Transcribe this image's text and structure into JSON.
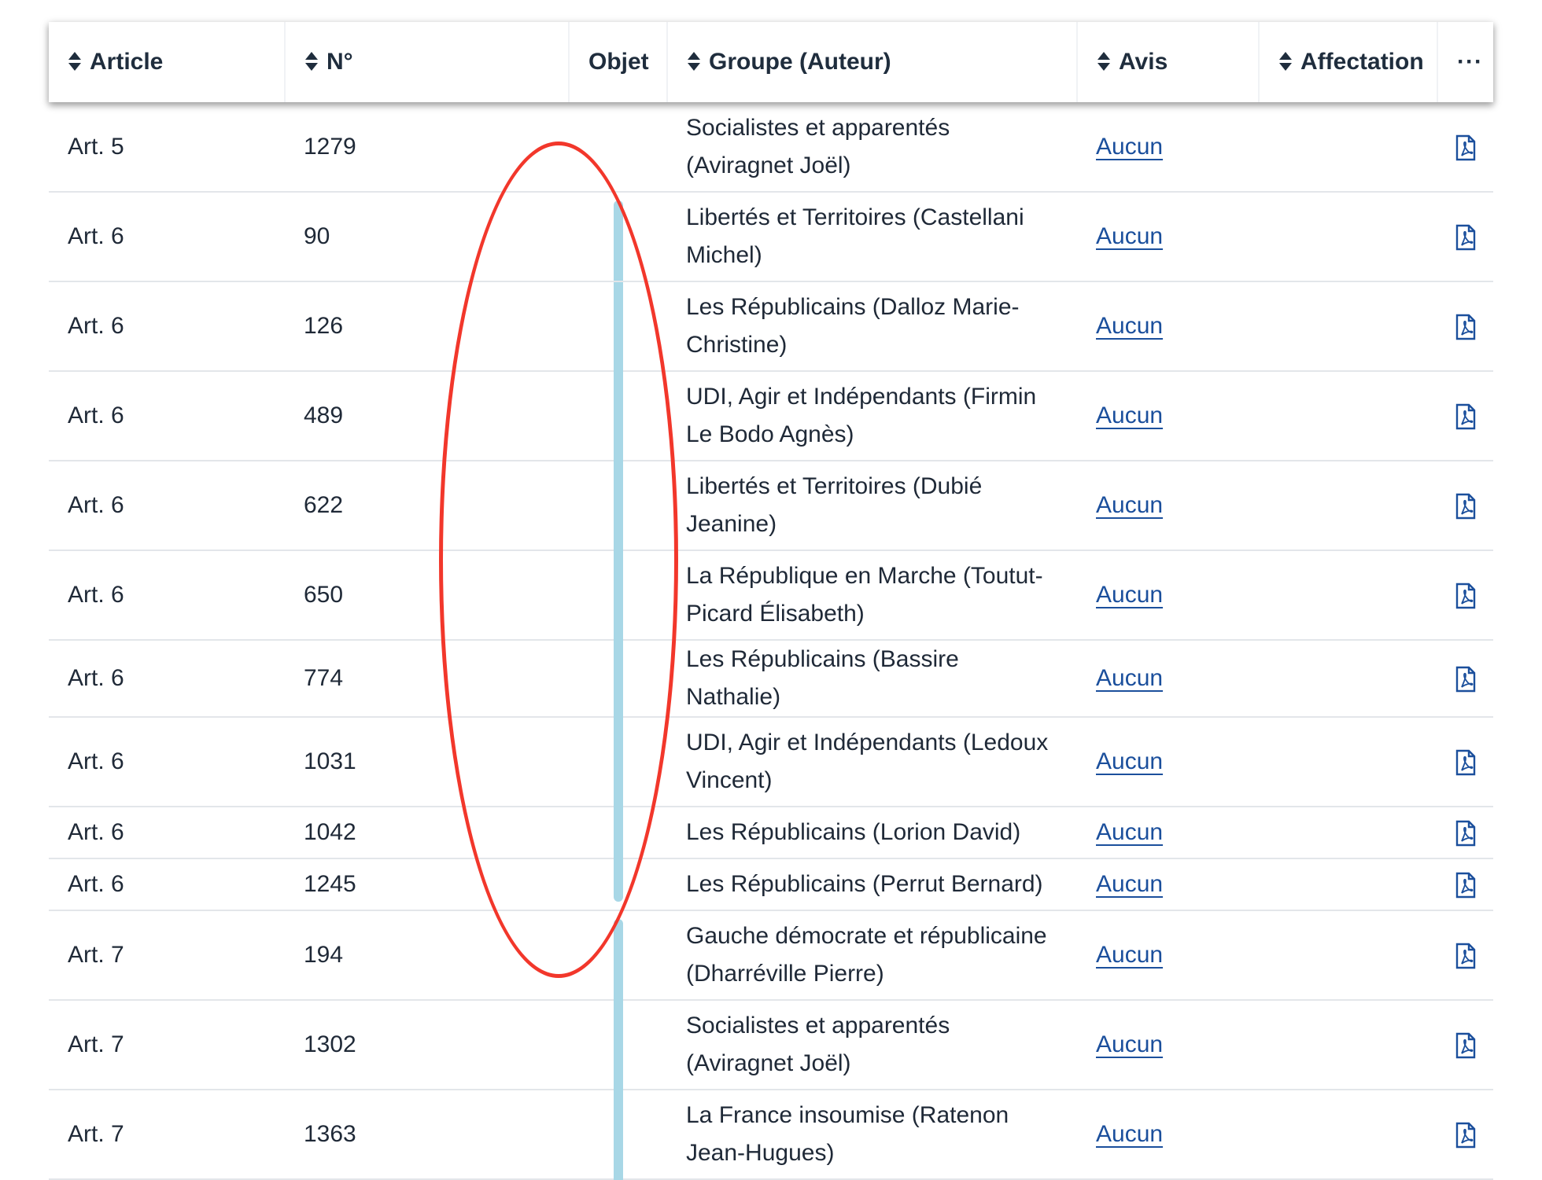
{
  "header": {
    "article": "Article",
    "numero": "N°",
    "objet": "Objet",
    "groupe": "Groupe (Auteur)",
    "avis": "Avis",
    "affectation": "Affectation",
    "more": "···"
  },
  "rows": [
    {
      "article": "Art. 5",
      "numero": "1279",
      "groupe": "Socialistes et apparentés (Aviragnet Joël)",
      "avis": "Aucun"
    },
    {
      "article": "Art. 6",
      "numero": "90",
      "groupe": "Libertés et Territoires (Castellani Michel)",
      "avis": "Aucun"
    },
    {
      "article": "Art. 6",
      "numero": "126",
      "groupe": "Les Républicains (Dalloz Marie-Christine)",
      "avis": "Aucun"
    },
    {
      "article": "Art. 6",
      "numero": "489",
      "groupe": "UDI, Agir et Indépendants (Firmin Le Bodo Agnès)",
      "avis": "Aucun"
    },
    {
      "article": "Art. 6",
      "numero": "622",
      "groupe": "Libertés et Territoires (Dubié Jeanine)",
      "avis": "Aucun"
    },
    {
      "article": "Art. 6",
      "numero": "650",
      "groupe": "La République en Marche (Toutut-Picard Élisabeth)",
      "avis": "Aucun"
    },
    {
      "article": "Art. 6",
      "numero": "774",
      "groupe": "Les Républicains (Bassire Nathalie)",
      "avis": "Aucun"
    },
    {
      "article": "Art. 6",
      "numero": "1031",
      "groupe": "UDI, Agir et Indépendants (Ledoux Vincent)",
      "avis": "Aucun"
    },
    {
      "article": "Art. 6",
      "numero": "1042",
      "groupe": "Les Républicains (Lorion David)",
      "avis": "Aucun"
    },
    {
      "article": "Art. 6",
      "numero": "1245",
      "groupe": "Les Républicains (Perrut Bernard)",
      "avis": "Aucun"
    },
    {
      "article": "Art. 7",
      "numero": "194",
      "groupe": "Gauche démocrate et républicaine (Dharréville Pierre)",
      "avis": "Aucun"
    },
    {
      "article": "Art. 7",
      "numero": "1302",
      "groupe": "Socialistes et apparentés (Aviragnet Joël)",
      "avis": "Aucun"
    },
    {
      "article": "Art. 7",
      "numero": "1363",
      "groupe": "La France insoumise (Ratenon Jean-Hugues)",
      "avis": "Aucun"
    }
  ],
  "colors": {
    "link": "#1b4f9c",
    "objet_bar": "#a8d7e6",
    "annotation": "#f2372b"
  }
}
